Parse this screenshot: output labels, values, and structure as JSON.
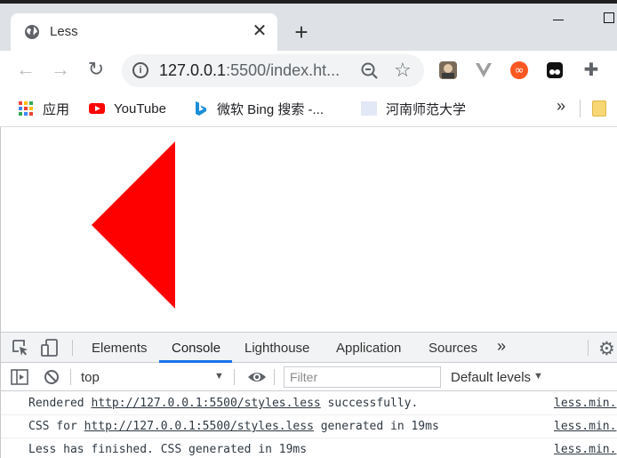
{
  "browser": {
    "tab": {
      "title": "Less",
      "close_glyph": "✕"
    },
    "new_tab_glyph": "+",
    "url": {
      "host": "127.0.0.1",
      "rest": ":5500/index.ht..."
    },
    "bookmarks": [
      {
        "label": "应用",
        "icon": "apps-grid-icon"
      },
      {
        "label": "YouTube",
        "icon": "youtube-icon"
      },
      {
        "label": "微软 Bing 搜索 -...",
        "icon": "bing-icon"
      },
      {
        "label": "河南师范大学",
        "icon": "page-icon"
      }
    ],
    "bookmarks_more": "»"
  },
  "page": {
    "shape": {
      "type": "triangle",
      "direction": "left",
      "color": "#ff0000"
    }
  },
  "devtools": {
    "tabs": [
      {
        "label": "Elements"
      },
      {
        "label": "Console",
        "active": true
      },
      {
        "label": "Lighthouse"
      },
      {
        "label": "Application"
      },
      {
        "label": "Sources"
      }
    ],
    "more_glyph": "»",
    "context": "top",
    "filter_placeholder": "Filter",
    "levels": "Default levels",
    "logs": [
      {
        "pre": "Rendered ",
        "link": "http://127.0.0.1:5500/styles.less",
        "post": " successfully.",
        "source": "less.min."
      },
      {
        "pre": "CSS for ",
        "link": "http://127.0.0.1:5500/styles.less",
        "post": " generated in 19ms",
        "source": "less.min."
      },
      {
        "pre": "Less has finished. CSS generated in 19ms",
        "link": "",
        "post": "",
        "source": "less.min."
      }
    ]
  },
  "colors": {
    "accent": "#1a73e8",
    "tabstrip": "#dee1e6"
  }
}
